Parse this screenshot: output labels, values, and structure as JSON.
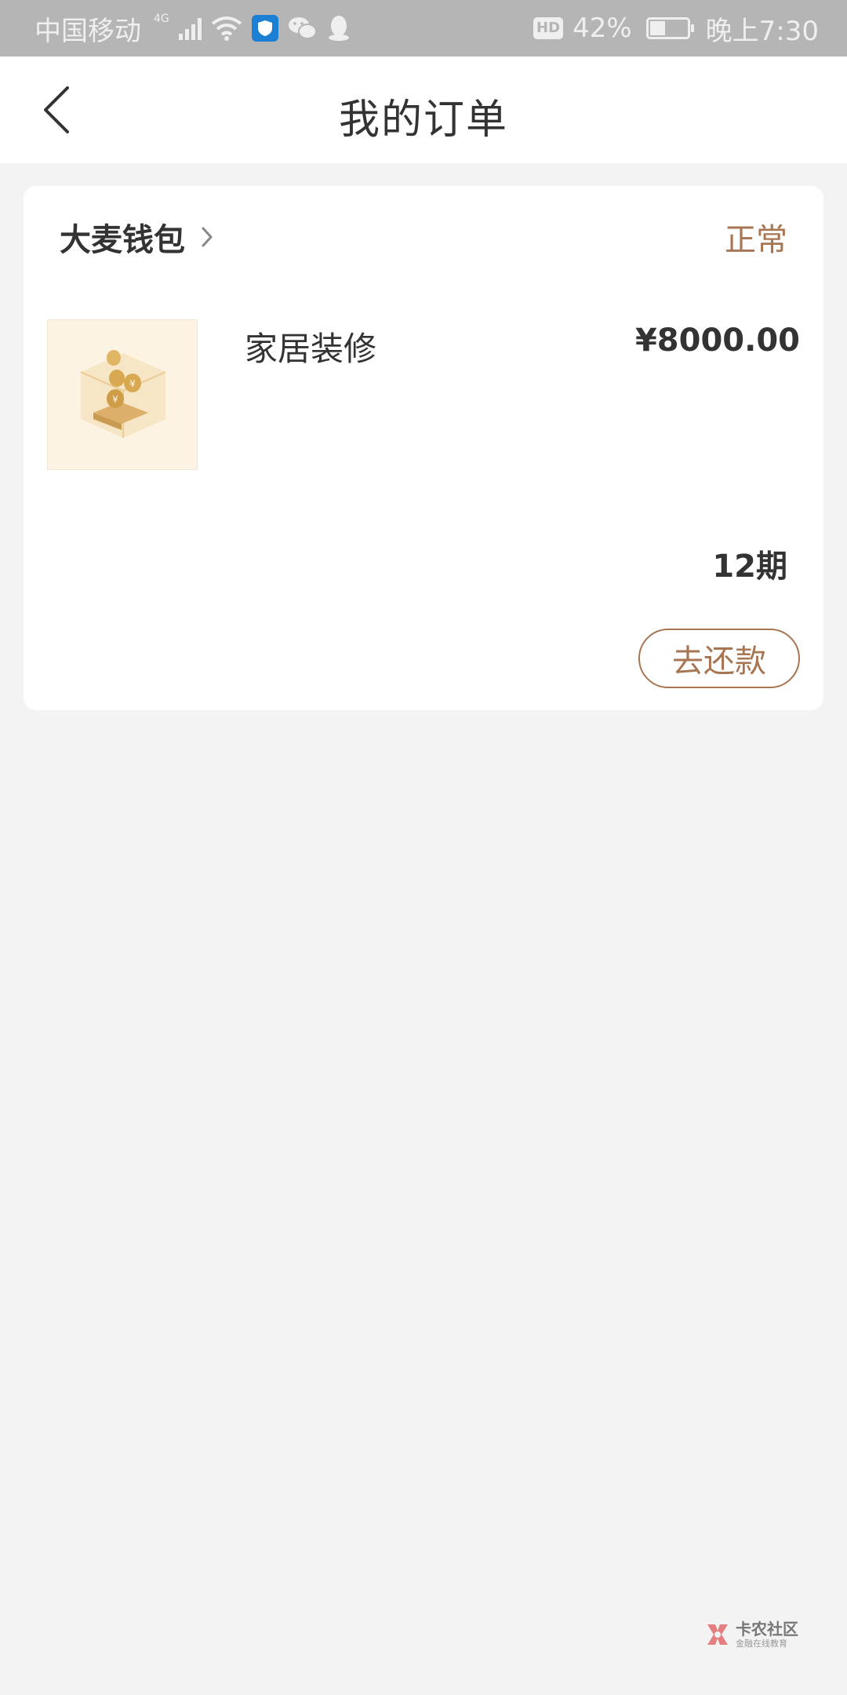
{
  "status_bar": {
    "carrier": "中国移动",
    "network": "4G",
    "hd": "HD",
    "battery_percent": "42%",
    "battery_level": 0.42,
    "time": "晚上7:30"
  },
  "nav": {
    "title": "我的订单"
  },
  "order": {
    "merchant": "大麦钱包",
    "status": "正常",
    "product_name": "家居装修",
    "price": "¥8000.00",
    "term": "12期",
    "repay_label": "去还款"
  },
  "watermark": {
    "title": "卡农社区",
    "subtitle": "金融在线教育"
  },
  "colors": {
    "accent": "#a87552",
    "status_bar_bg": "#b5b5b5",
    "page_bg": "#f3f3f3"
  }
}
